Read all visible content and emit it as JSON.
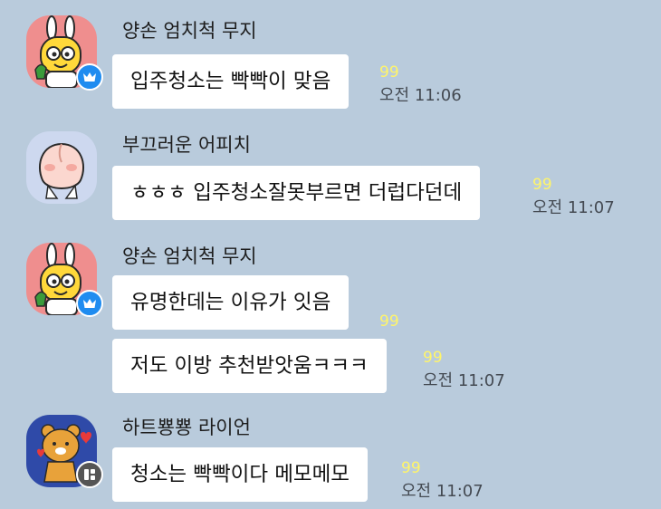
{
  "colors": {
    "background": "#b9cbdc",
    "bubble": "#ffffff",
    "unread_count": "#fff56a",
    "crown_badge": "#1f8cf0",
    "memo_badge": "#555555"
  },
  "messages": [
    {
      "sender": "양손 엄치척 무지",
      "avatar_icon": "muzi-thumbs-up-avatar-icon",
      "badge_icon": "crown-icon",
      "bubbles": [
        {
          "text": "입주청소는 빡빡이 맞음",
          "count": "99",
          "time": "오전 11:06"
        }
      ]
    },
    {
      "sender": "부끄러운 어피치",
      "avatar_icon": "apeach-avatar-icon",
      "badge_icon": "",
      "bubbles": [
        {
          "text": "ㅎㅎㅎ 입주청소잘못부르면 더럽다던데",
          "count": "99",
          "time": "오전 11:07"
        }
      ]
    },
    {
      "sender": "양손 엄치척 무지",
      "avatar_icon": "muzi-thumbs-up-avatar-icon",
      "badge_icon": "crown-icon",
      "bubbles": [
        {
          "text": "유명한데는 이유가 잇음",
          "count": "99",
          "time": ""
        },
        {
          "text": "저도 이방 추천받앗움ㅋㅋㅋ",
          "count": "99",
          "time": "오전 11:07"
        }
      ]
    },
    {
      "sender": "하트뿅뿅 라이언",
      "avatar_icon": "ryan-heart-avatar-icon",
      "badge_icon": "memo-icon",
      "bubbles": [
        {
          "text": "청소는 빡빡이다 메모메모",
          "count": "99",
          "time": "오전 11:07"
        }
      ]
    }
  ]
}
